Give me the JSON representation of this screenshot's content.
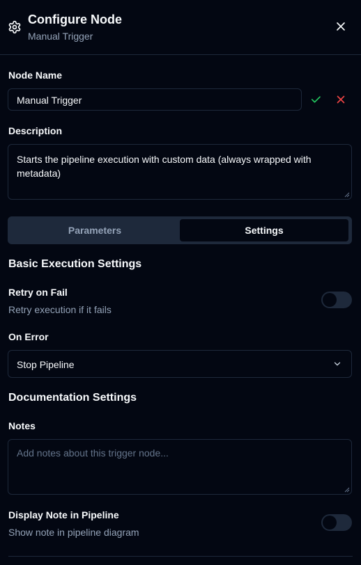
{
  "header": {
    "title": "Configure Node",
    "subtitle": "Manual Trigger",
    "icons": {
      "settings": "gear-icon",
      "close": "close-icon"
    }
  },
  "node_name": {
    "label": "Node Name",
    "value": "Manual Trigger",
    "confirm_icon": "check-icon",
    "cancel_icon": "x-icon"
  },
  "description": {
    "label": "Description",
    "value": "Starts the pipeline execution with custom data (always wrapped with metadata)"
  },
  "tabs": [
    {
      "label": "Parameters",
      "active": false
    },
    {
      "label": "Settings",
      "active": true
    }
  ],
  "basic_execution": {
    "title": "Basic Execution Settings",
    "retry_on_fail": {
      "label": "Retry on Fail",
      "help": "Retry execution if it fails",
      "enabled": false
    },
    "on_error": {
      "label": "On Error",
      "selected": "Stop Pipeline"
    }
  },
  "documentation": {
    "title": "Documentation Settings",
    "notes": {
      "label": "Notes",
      "value": "",
      "placeholder": "Add notes about this trigger node..."
    },
    "display_note": {
      "label": "Display Note in Pipeline",
      "help": "Show note in pipeline diagram",
      "enabled": false
    }
  },
  "colors": {
    "background": "#030712",
    "border": "#1e293b",
    "muted_text": "#94a3b8",
    "confirm": "#22c55e",
    "cancel": "#ef4444"
  }
}
